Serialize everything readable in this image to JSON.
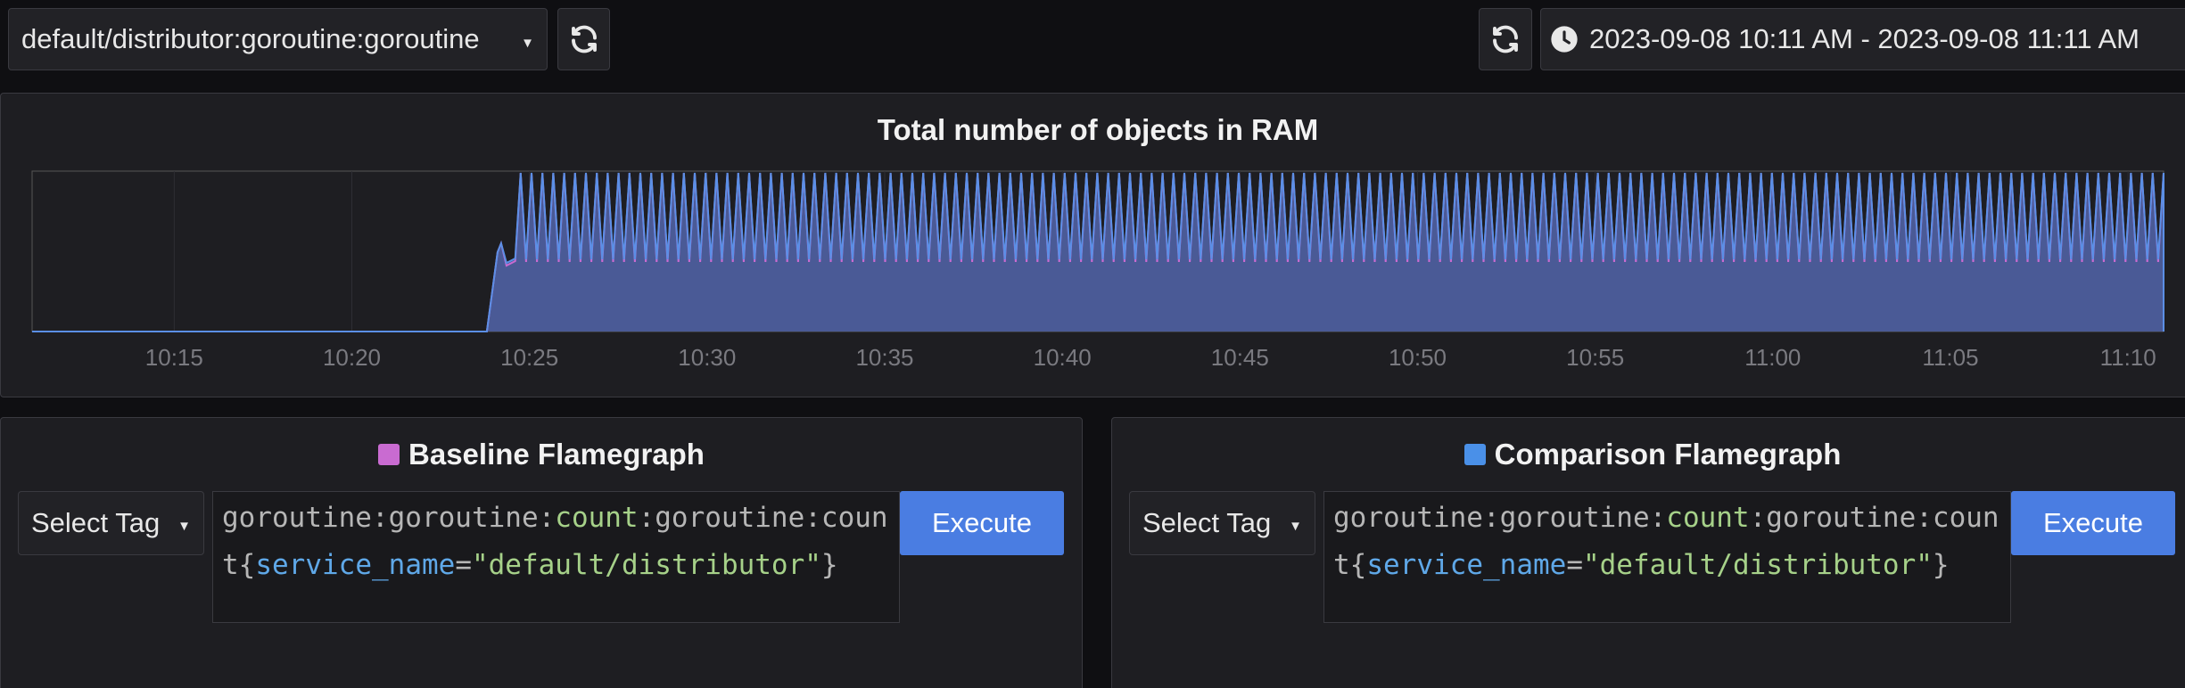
{
  "toolbar": {
    "app_name": "default/distributor:goroutine:goroutine",
    "time_range": "2023-09-08 10:11 AM - 2023-09-08 11:11 AM"
  },
  "timeline": {
    "title": "Total number of objects in RAM",
    "tick_labels": [
      "10:15",
      "10:20",
      "10:25",
      "10:30",
      "10:35",
      "10:40",
      "10:45",
      "10:50",
      "10:55",
      "11:00",
      "11:05",
      "11:10"
    ]
  },
  "baseline": {
    "title": "Baseline Flamegraph",
    "select_label": "Select Tag",
    "query": {
      "p1": "goroutine:goroutine:",
      "count": "count",
      "p2": ":goroutine:count",
      "brace_open": "{",
      "key": "service_name",
      "eq": "=",
      "value": "\"default/distributor\"",
      "brace_close": "}"
    },
    "execute_label": "Execute",
    "color": "#c96bd1"
  },
  "comparison": {
    "title": "Comparison Flamegraph",
    "select_label": "Select Tag",
    "query": {
      "p1": "goroutine:goroutine:",
      "count": "count",
      "p2": ":goroutine:count",
      "brace_open": "{",
      "key": "service_name",
      "eq": "=",
      "value": "\"default/distributor\"",
      "brace_close": "}"
    },
    "execute_label": "Execute",
    "color": "#4a90e8"
  },
  "colors": {
    "accent_blue": "#4a7de2",
    "baseline_series": "#c96bd1",
    "comparison_series": "#5b8fe6"
  }
}
